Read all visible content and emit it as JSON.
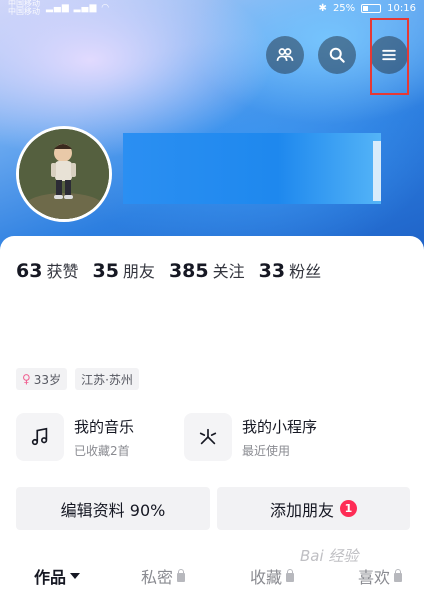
{
  "status_bar": {
    "carrier_1": "中国移动",
    "carrier_2": "中国移动",
    "battery": "25%",
    "time": "10:16"
  },
  "header": {
    "friends_icon": "people-icon",
    "search_icon": "search-icon",
    "menu_icon": "hamburger-menu-icon"
  },
  "stats": [
    {
      "num": "63",
      "label": "获赞"
    },
    {
      "num": "35",
      "label": "朋友"
    },
    {
      "num": "385",
      "label": "关注"
    },
    {
      "num": "33",
      "label": "粉丝"
    }
  ],
  "tags": {
    "age": "33岁",
    "location": "江苏·苏州"
  },
  "features": {
    "music_title": "我的音乐",
    "music_sub": "已收藏2首",
    "miniapp_title": "我的小程序",
    "miniapp_sub": "最近使用"
  },
  "buttons": {
    "edit_profile": "编辑资料 90%",
    "add_friend": "添加朋友",
    "add_friend_badge": "1"
  },
  "tabs": {
    "works": "作品",
    "private": "私密",
    "favorites": "收藏",
    "likes": "喜欢"
  },
  "watermark": "Bai 经验",
  "colors": {
    "accent_red": "#fe2c55",
    "highlight_box": "#e53935"
  }
}
